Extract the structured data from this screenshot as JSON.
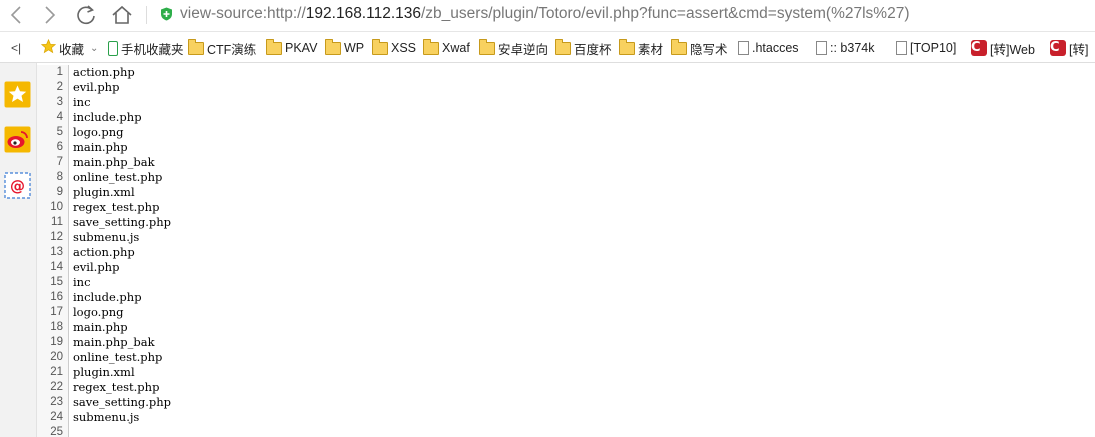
{
  "url": {
    "prefix": "view-source:http://",
    "host": "192.168.112.136",
    "path": "/zb_users/plugin/Totoro/evil.php?func=assert&cmd=system(%27ls%27)"
  },
  "nav_icons": [
    "back-icon",
    "forward-icon",
    "reload-icon",
    "home-icon"
  ],
  "bookmarks": [
    {
      "label": "收藏",
      "icon": "star-icon",
      "extra": "⌄"
    },
    {
      "label": "手机收藏夹",
      "icon": "phone-icon"
    },
    {
      "label": "CTF演练",
      "icon": "folder-icon"
    },
    {
      "label": "PKAV",
      "icon": "folder-icon"
    },
    {
      "label": "WP",
      "icon": "folder-icon"
    },
    {
      "label": "XSS",
      "icon": "folder-icon"
    },
    {
      "label": "Xwaf",
      "icon": "folder-icon"
    },
    {
      "label": "安卓逆向",
      "icon": "folder-icon"
    },
    {
      "label": "百度杯",
      "icon": "folder-icon"
    },
    {
      "label": "素材",
      "icon": "folder-icon"
    },
    {
      "label": "隐写术",
      "icon": "folder-icon"
    },
    {
      "label": ".htacces",
      "icon": "page-icon"
    },
    {
      "label": ":: b374k",
      "icon": "page-icon"
    },
    {
      "label": "[TOP10]",
      "icon": "page-icon"
    },
    {
      "label": "[转]Web",
      "icon": "csdn-icon"
    },
    {
      "label": "[转]",
      "icon": "csdn-icon"
    }
  ],
  "bookmarks_collapse": "<|",
  "side_icons": [
    "favorites-star-icon",
    "weibo-icon",
    "mail-at-icon"
  ],
  "source_lines": [
    {
      "n": "1",
      "text": "action.php"
    },
    {
      "n": "2",
      "text": "evil.php"
    },
    {
      "n": "3",
      "text": "inc"
    },
    {
      "n": "4",
      "text": "include.php"
    },
    {
      "n": "5",
      "text": "logo.png"
    },
    {
      "n": "6",
      "text": "main.php"
    },
    {
      "n": "7",
      "text": "main.php_bak"
    },
    {
      "n": "8",
      "text": "online_test.php"
    },
    {
      "n": "9",
      "text": "plugin.xml"
    },
    {
      "n": "10",
      "text": "regex_test.php"
    },
    {
      "n": "11",
      "text": "save_setting.php"
    },
    {
      "n": "12",
      "text": "submenu.js"
    },
    {
      "n": "13",
      "text": "action.php"
    },
    {
      "n": "14",
      "text": "evil.php"
    },
    {
      "n": "15",
      "text": "inc"
    },
    {
      "n": "16",
      "text": "include.php"
    },
    {
      "n": "17",
      "text": "logo.png"
    },
    {
      "n": "18",
      "text": "main.php"
    },
    {
      "n": "19",
      "text": "main.php_bak"
    },
    {
      "n": "20",
      "text": "online_test.php"
    },
    {
      "n": "21",
      "text": "plugin.xml"
    },
    {
      "n": "22",
      "text": "regex_test.php"
    },
    {
      "n": "23",
      "text": "save_setting.php"
    },
    {
      "n": "24",
      "text": "submenu.js"
    },
    {
      "n": "25",
      "text": ""
    }
  ]
}
